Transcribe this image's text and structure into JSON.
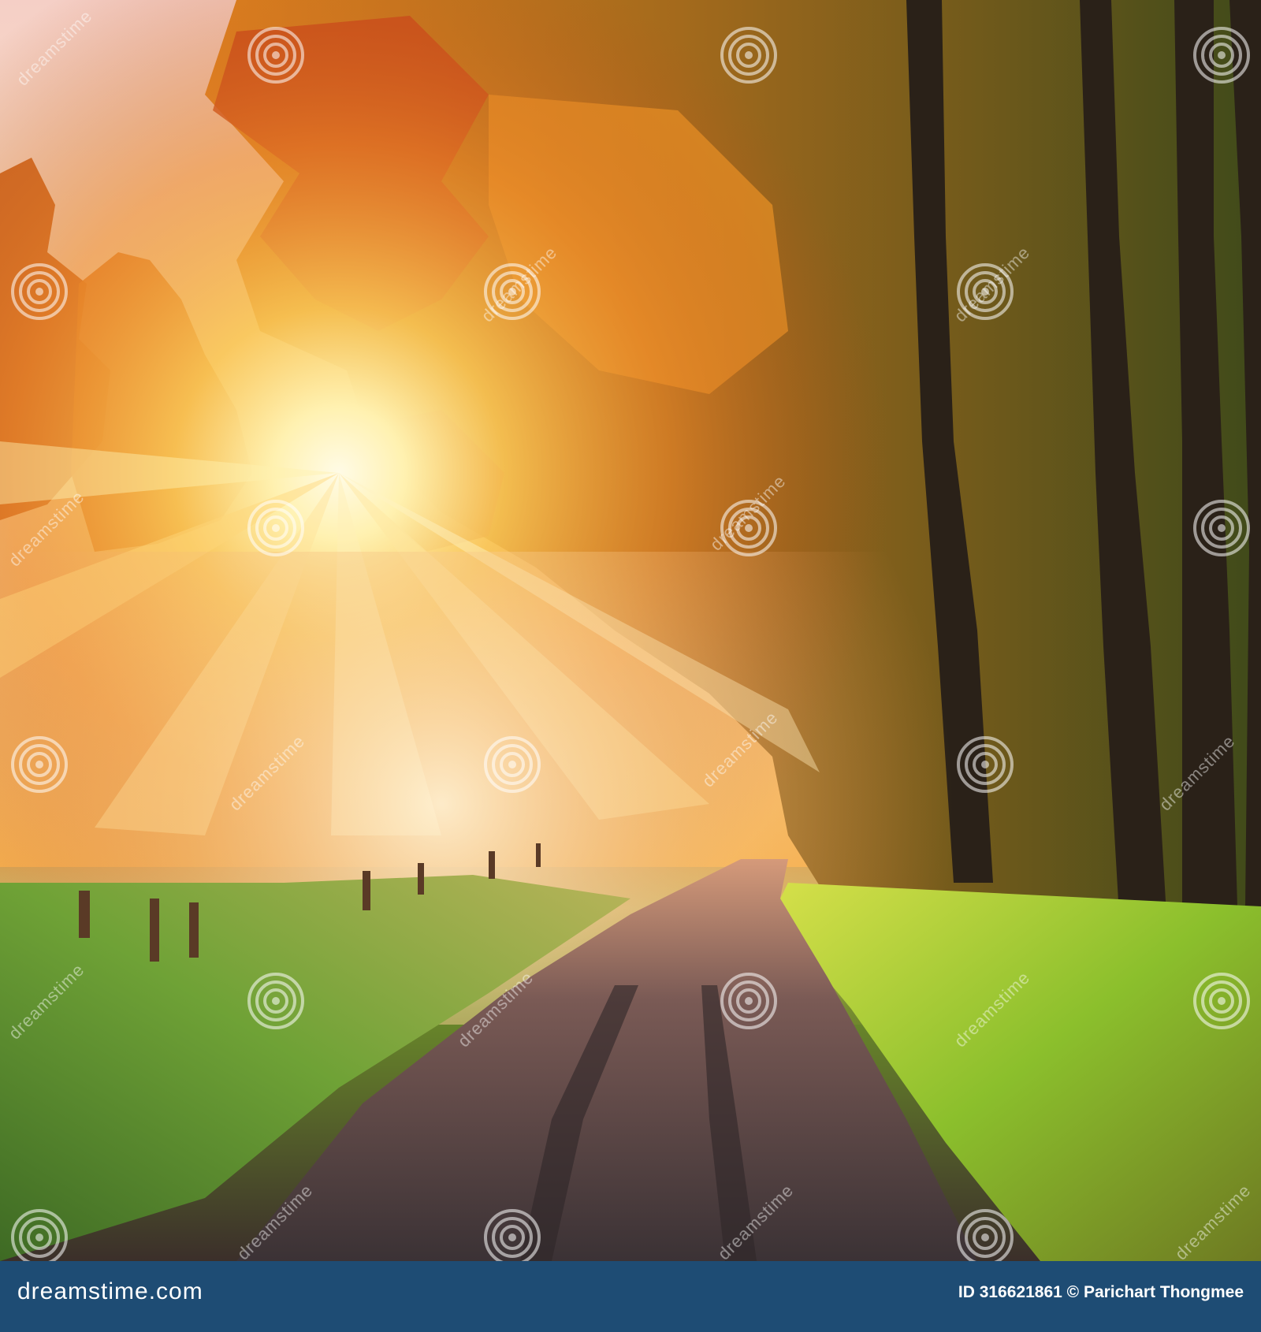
{
  "photo": {
    "alt_subject": "forest",
    "colors": {
      "sky_top": "#f6d2c4",
      "sun_glow": "#fff6c8",
      "foliage_orange": "#e8821f",
      "foliage_red": "#c2431a",
      "foliage_green": "#5f7a1e",
      "trunk": "#2a2118",
      "road": "#4a3e3c",
      "grass": "#7cc23a"
    }
  },
  "watermark": {
    "text": "dreamstime",
    "icon": "spiral-logo-icon"
  },
  "footer": {
    "logo_text": "dreamstime.com",
    "credit_text": "ID 316621861 © Parichart Thongmee",
    "background": "#1e4c74"
  }
}
